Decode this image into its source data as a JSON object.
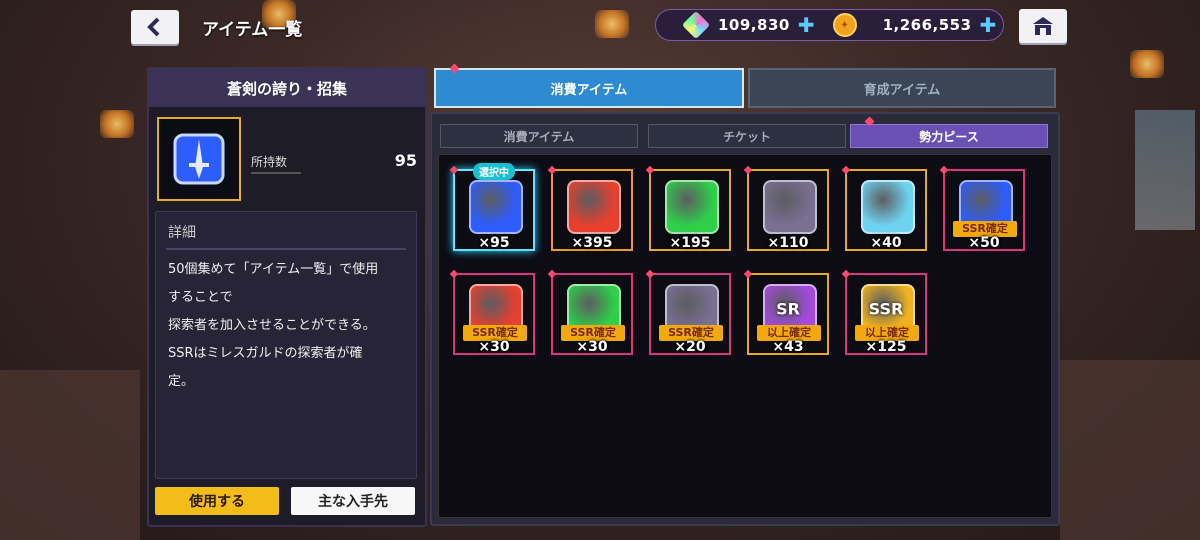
{
  "header": {
    "title": "アイテム一覧",
    "gems": "109,830",
    "coins": "1,266,553"
  },
  "left": {
    "item_name": "蒼剣の誇り・招集",
    "own_label": "所持数",
    "own_count": "95",
    "detail_title": "詳細",
    "detail_text": "50個集めて「アイテム一覧」で使用\nすることで\n探索者を加入させることができる。\nSSRはミレスガルドの探索者が確\n定。",
    "use_button": "使用する",
    "source_button": "主な入手先"
  },
  "tabs": {
    "active": "消費アイテム",
    "inactive": "育成アイテム"
  },
  "subtabs": [
    "消費アイテム",
    "チケット",
    "勢力ピース"
  ],
  "grid": {
    "selected_tag": "選択中",
    "items": [
      {
        "qty": "×95",
        "color": "#2d5cff",
        "frame": "#e7a92a",
        "badge": "",
        "label": ""
      },
      {
        "qty": "×395",
        "color": "#e8402e",
        "frame": "#e79a2a",
        "badge": "",
        "label": ""
      },
      {
        "qty": "×195",
        "color": "#2fcf4a",
        "frame": "#e7a92a",
        "badge": "",
        "label": ""
      },
      {
        "qty": "×110",
        "color": "#7a7092",
        "frame": "#e7a92a",
        "badge": "",
        "label": ""
      },
      {
        "qty": "×40",
        "color": "#6ed3f0",
        "frame": "#e7a92a",
        "badge": "",
        "label": ""
      },
      {
        "qty": "×50",
        "color": "#2d5cff",
        "frame": "#d8357a",
        "badge": "SSR確定",
        "label": ""
      },
      {
        "qty": "×30",
        "color": "#e8402e",
        "frame": "#d8357a",
        "badge": "SSR確定",
        "label": ""
      },
      {
        "qty": "×30",
        "color": "#2fcf4a",
        "frame": "#d8357a",
        "badge": "SSR確定",
        "label": ""
      },
      {
        "qty": "×20",
        "color": "#7a7092",
        "frame": "#d8357a",
        "badge": "SSR確定",
        "label": ""
      },
      {
        "qty": "×43",
        "color": "#a44ae0",
        "frame": "#e7a92a",
        "badge": "以上確定",
        "label": "SR"
      },
      {
        "qty": "×125",
        "color": "#f0b320",
        "frame": "#d8357a",
        "badge": "以上確定",
        "label": "SSR"
      }
    ]
  }
}
